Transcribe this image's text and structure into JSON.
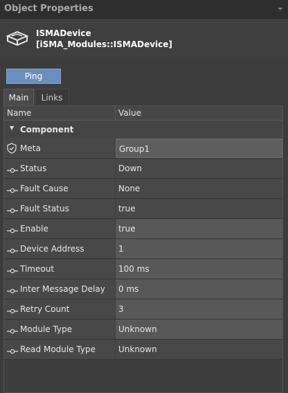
{
  "panel": {
    "title": "Object Properties",
    "pin_glyph": "⫧"
  },
  "object": {
    "name": "ISMADevice",
    "type": "[iSMA_Modules::ISMADevice]",
    "icon": "device-icon"
  },
  "actions": {
    "ping_label": "Ping"
  },
  "tabs": [
    {
      "label": "Main",
      "active": true
    },
    {
      "label": "Links",
      "active": false
    }
  ],
  "grid": {
    "col_name": "Name",
    "col_value": "Value",
    "section_label": "Component",
    "rows": [
      {
        "name": "Meta",
        "value": "Group1",
        "icon": "shield-icon"
      },
      {
        "name": "Status",
        "value": "Down",
        "icon": "slot-icon"
      },
      {
        "name": "Fault Cause",
        "value": "None",
        "icon": "slot-icon"
      },
      {
        "name": "Fault Status",
        "value": "true",
        "icon": "slot-icon"
      },
      {
        "name": "Enable",
        "value": "true",
        "icon": "slot-icon"
      },
      {
        "name": "Device Address",
        "value": "1",
        "icon": "slot-icon"
      },
      {
        "name": "Timeout",
        "value": "100 ms",
        "icon": "slot-icon"
      },
      {
        "name": "Inter Message Delay",
        "value": "0 ms",
        "icon": "slot-icon"
      },
      {
        "name": "Retry Count",
        "value": "3",
        "icon": "slot-icon"
      },
      {
        "name": "Module Type",
        "value": "Unknown",
        "icon": "slot-icon"
      },
      {
        "name": "Read Module Type",
        "value": "Unknown",
        "icon": "slot-icon"
      }
    ]
  },
  "colors": {
    "accent": "#6a8fbf",
    "background": "#3c3c3c"
  }
}
